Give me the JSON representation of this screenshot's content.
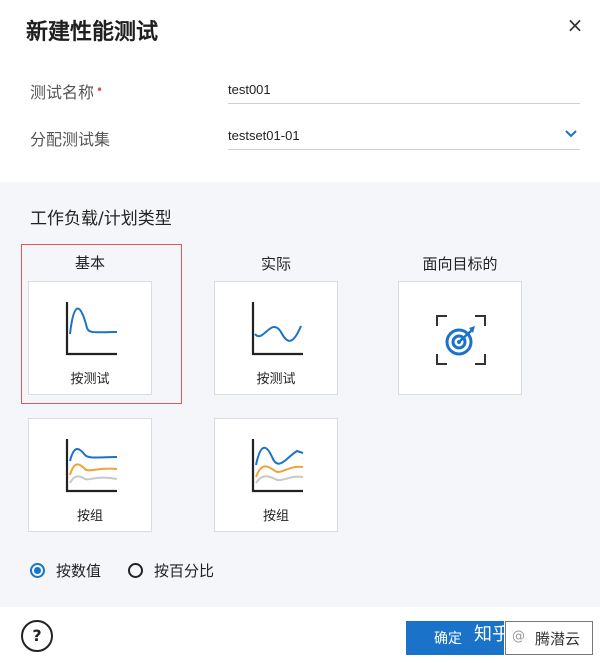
{
  "dialog": {
    "title": "新建性能测试",
    "close_label": "×"
  },
  "form": {
    "test_name_label": "测试名称",
    "test_name_required": "•",
    "test_name_value": "test001",
    "testset_label": "分配测试集",
    "testset_value": "testset01-01"
  },
  "workload": {
    "section_title": "工作负载/计划类型",
    "columns": {
      "basic": "基本",
      "actual": "实际",
      "goal": "面向目标的"
    },
    "cards": {
      "basic_by_test": "按测试",
      "actual_by_test": "按测试",
      "basic_by_group": "按组",
      "actual_by_group": "按组"
    },
    "selected": "basic_by_test",
    "colors": {
      "blue": "#1a73c8",
      "orange": "#f0a23a",
      "gray": "#c8c8c8",
      "axis": "#222222"
    }
  },
  "mode": {
    "by_value": "按数值",
    "by_percent": "按百分比",
    "selected": "by_value"
  },
  "footer": {
    "help": "?",
    "confirm": "确定",
    "watermark": "知乎",
    "watermark2": "@",
    "watermark3": "腾潜云"
  }
}
